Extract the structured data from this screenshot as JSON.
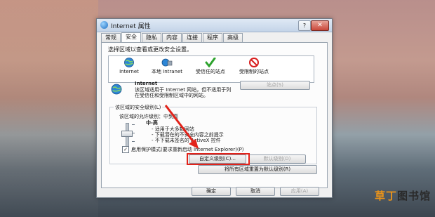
{
  "window": {
    "title": "Internet 属性",
    "help": "?",
    "close": "✕"
  },
  "tabs": [
    "常规",
    "安全",
    "隐私",
    "内容",
    "连接",
    "程序",
    "高级"
  ],
  "active_tab": "安全",
  "security": {
    "zone_prompt": "选择区域以查看或更改安全设置。",
    "zones": [
      {
        "label": "Internet"
      },
      {
        "label": "本地 Intranet"
      },
      {
        "label": "受信任的站点"
      },
      {
        "label": "受限制的站点"
      }
    ],
    "selected_zone_name": "Internet",
    "zone_description": "该区域适用于 Internet 网站，但不适用于列在受信任和受限制区域中的网站。",
    "sites_button": "站点(S)",
    "level_group_title": "该区域的安全级别(L)",
    "allowed_levels": "该区域的允许级别：中到高",
    "level_name": "中-高",
    "bullets": [
      "- 适用于大多数网站",
      "- 下载潜在的不安全内容之前提示",
      "- 不下载未签名的 ActiveX 控件"
    ],
    "protected_mode_label": "启用保护模式(要求重新启动 Internet Explorer)(P)",
    "protected_mode_checked": true,
    "custom_level_button": "自定义级别(C)...",
    "default_level_button": "默认级别(D)",
    "reset_all_button": "将所有区域重置为默认级别(R)"
  },
  "footer": {
    "ok": "确定",
    "cancel": "取消",
    "apply": "应用(A)"
  },
  "watermark": {
    "text1": "草丁",
    "text2": "图书馆",
    "color1": "#e8931b",
    "color2": "#2a2a2a"
  },
  "annotation_color": "#e2231a"
}
